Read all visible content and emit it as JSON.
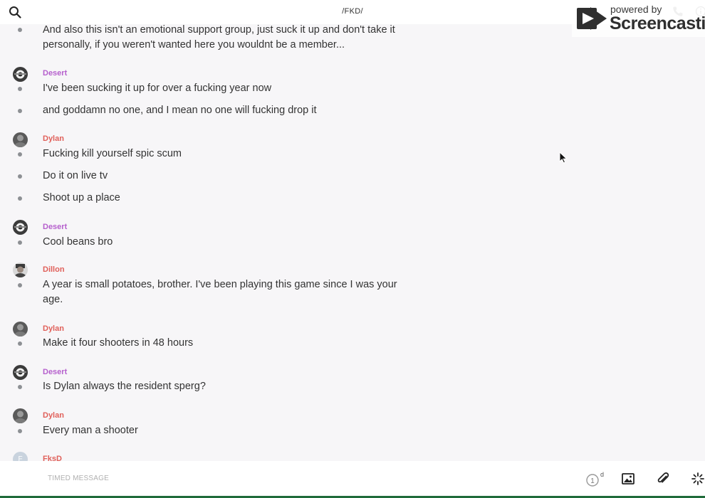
{
  "header": {
    "title": "/FKD/"
  },
  "watermark": {
    "powered": "powered by",
    "brand": "Screencastify"
  },
  "messages": {
    "m0": {
      "text": "And also this isn't an emotional support group, just suck it up and don't take it personally, if you weren't wanted here you wouldnt be a member..."
    },
    "g1": {
      "author": "Desert",
      "author_color": "#b660cd"
    },
    "m1": {
      "text": "I've been sucking it up for over a fucking year now"
    },
    "m2": {
      "text": "and goddamn no one, and I mean no one will fucking drop it"
    },
    "g2": {
      "author": "Dylan",
      "author_color": "#e0605a"
    },
    "m3": {
      "text": "Fucking kill yourself spic scum"
    },
    "m4": {
      "text": "Do it on live tv"
    },
    "m5": {
      "text": "Shoot up a place"
    },
    "g3": {
      "author": "Desert",
      "author_color": "#b660cd"
    },
    "m6": {
      "text": "Cool beans bro"
    },
    "g4": {
      "author": "Dillon",
      "author_color": "#e0605a"
    },
    "m7": {
      "text": "A year is small potatoes, brother. I've been playing this game since I was your age."
    },
    "g5": {
      "author": "Dylan",
      "author_color": "#e0605a"
    },
    "m8": {
      "text": "Make it four shooters in 48 hours"
    },
    "g6": {
      "author": "Desert",
      "author_color": "#b660cd"
    },
    "m9": {
      "text": "Is Dylan always the resident sperg?"
    },
    "g7": {
      "author": "Dylan",
      "author_color": "#e0605a"
    },
    "m10": {
      "text": "Every man a shooter"
    },
    "g8": {
      "author": "FksD",
      "author_initial": "F",
      "author_color": "#e0605a"
    }
  },
  "composer": {
    "placeholder": "TIMED MESSAGE",
    "timer_value": "1",
    "timer_unit": "d"
  },
  "icons": {
    "search": "search-icon",
    "call": "phone-icon",
    "info": "info-icon",
    "timer": "timer-icon",
    "image": "image-icon",
    "attach": "paperclip-icon",
    "effects": "sparkle-icon"
  }
}
